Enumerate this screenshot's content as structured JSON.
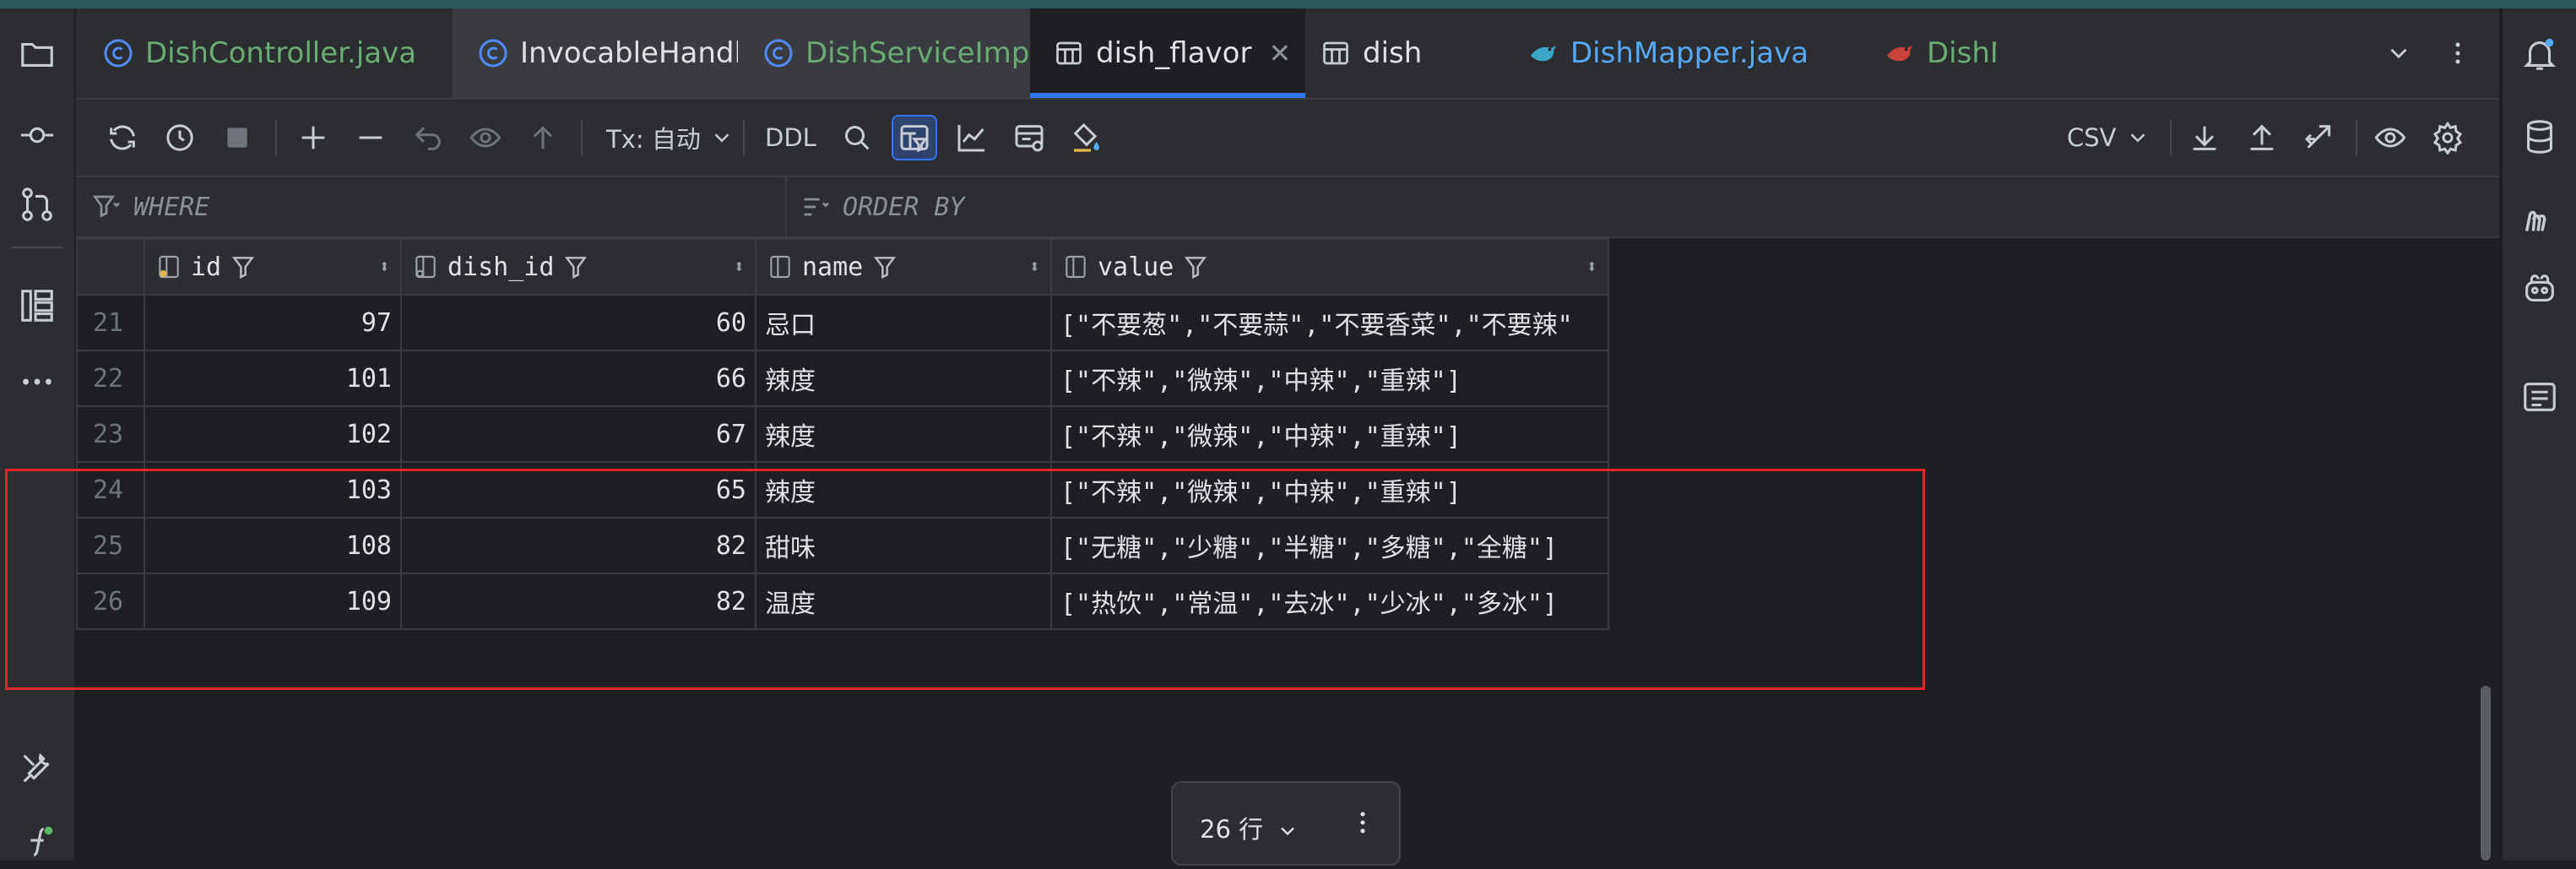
{
  "tabs": [
    {
      "label": "DishController.java",
      "kind": "class",
      "color": "green"
    },
    {
      "label": "InvocableHandlerMethod.class",
      "kind": "class",
      "color": "white"
    },
    {
      "label": "DishServiceImpl.java",
      "kind": "class",
      "color": "green"
    },
    {
      "label": "dish_flavor",
      "kind": "table",
      "color": "white",
      "active": true
    },
    {
      "label": "dish",
      "kind": "table",
      "color": "white"
    },
    {
      "label": "DishMapper.java",
      "kind": "mybatis",
      "color": "blue"
    },
    {
      "label": "DishMa",
      "kind": "mybatis",
      "color": "green"
    }
  ],
  "toolbar": {
    "tx_label": "Tx: 自动",
    "ddl_label": "DDL",
    "csv_label": "CSV"
  },
  "filter": {
    "where_label": "WHERE",
    "order_label": "ORDER BY"
  },
  "columns": [
    {
      "name": "id",
      "icon": "key-column-icon"
    },
    {
      "name": "dish_id",
      "icon": "foreign-key-column-icon"
    },
    {
      "name": "name",
      "icon": "column-icon"
    },
    {
      "name": "value",
      "icon": "column-icon"
    }
  ],
  "rows": [
    {
      "rownum": "21",
      "id": "97",
      "dish_id": "60",
      "name": "忌口",
      "value": "[\"不要葱\",\"不要蒜\",\"不要香菜\",\"不要辣\""
    },
    {
      "rownum": "22",
      "id": "101",
      "dish_id": "66",
      "name": "辣度",
      "value": "[\"不辣\",\"微辣\",\"中辣\",\"重辣\"]"
    },
    {
      "rownum": "23",
      "id": "102",
      "dish_id": "67",
      "name": "辣度",
      "value": "[\"不辣\",\"微辣\",\"中辣\",\"重辣\"]"
    },
    {
      "rownum": "24",
      "id": "103",
      "dish_id": "65",
      "name": "辣度",
      "value": "[\"不辣\",\"微辣\",\"中辣\",\"重辣\"]"
    },
    {
      "rownum": "25",
      "id": "108",
      "dish_id": "82",
      "name": "甜味",
      "value": "[\"无糖\",\"少糖\",\"半糖\",\"多糖\",\"全糖\"]"
    },
    {
      "rownum": "26",
      "id": "109",
      "dish_id": "82",
      "name": "温度",
      "value": "[\"热饮\",\"常温\",\"去冰\",\"少冰\",\"多冰\"]"
    }
  ],
  "pager": {
    "row_count": "26 行"
  },
  "colors": {
    "accent": "#3574f0",
    "annotation": "#e0242b",
    "green_tab": "#6aab73",
    "blue_tab": "#56a8f5"
  }
}
